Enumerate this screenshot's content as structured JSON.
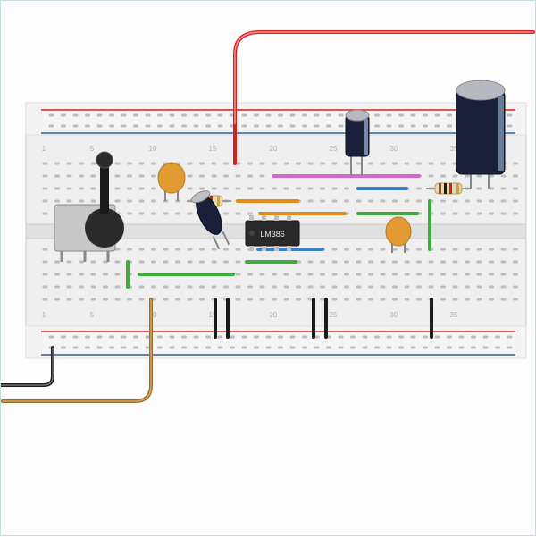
{
  "diagram": {
    "chip_label": "LM386",
    "column_numbers_top": [
      "1",
      "5",
      "10",
      "15",
      "20",
      "25",
      "30",
      "35"
    ],
    "column_numbers_bottom": [
      "1",
      "5",
      "10",
      "15",
      "20",
      "25",
      "30",
      "35"
    ],
    "components": {
      "potentiometer": "rotary-potentiometer",
      "chip": "LM386",
      "capacitors": [
        "ceramic-disc-1",
        "ceramic-disc-2",
        "electrolytic-small",
        "electrolytic-small-2",
        "electrolytic-large"
      ],
      "resistors": [
        "resistor-1",
        "resistor-2"
      ]
    },
    "wire_colors": {
      "power": "#d62020",
      "ground": "#1a1a1a",
      "signal_green": "#3dab3d",
      "signal_orange": "#e28a1a",
      "signal_pink": "#d468c8",
      "signal_blue": "#3d7fc8",
      "signal_brown": "#9c6a2f"
    }
  }
}
